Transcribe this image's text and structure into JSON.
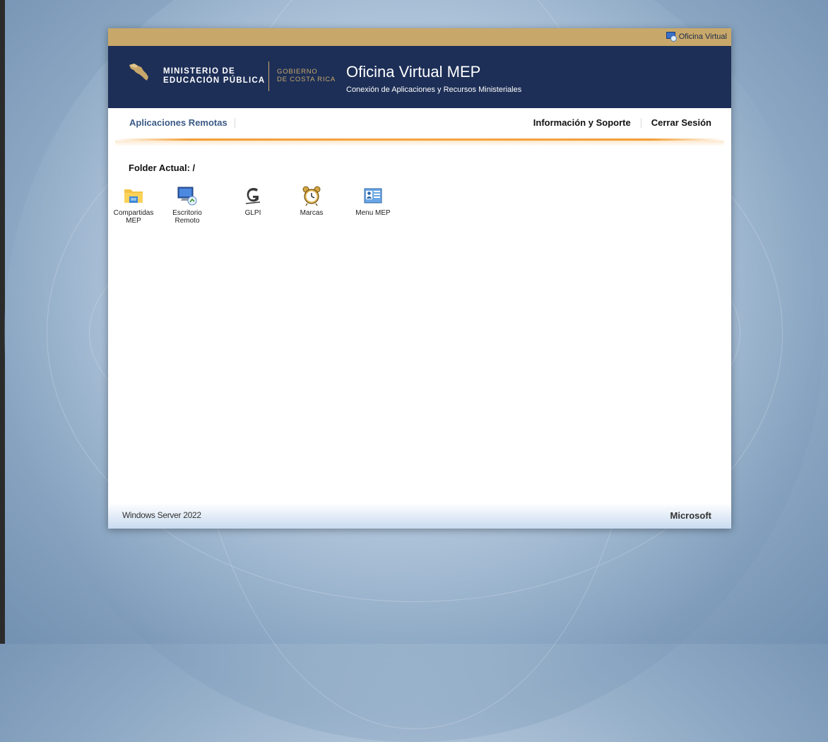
{
  "topbar": {
    "link_label": "Oficina Virtual",
    "link_icon": "remote-app-icon"
  },
  "header": {
    "ministry_line1": "MINISTERIO DE",
    "ministry_line2": "EDUCACIÓN PÚBLICA",
    "gov_line1": "GOBIERNO",
    "gov_line2": "DE COSTA RICA",
    "title": "Oficina Virtual MEP",
    "subtitle": "Conexión de Aplicaciones y Recursos Ministeriales",
    "colors": {
      "header_bg": "#1d2f57",
      "topbar_bg": "#c8a86a",
      "accent_gold": "#c8a86a"
    }
  },
  "nav": {
    "left": [
      {
        "label": "Aplicaciones Remotas"
      }
    ],
    "right": [
      {
        "label": "Información y Soporte"
      },
      {
        "label": "Cerrar Sesión"
      }
    ],
    "colors": {
      "active": "#3b5a86",
      "underline_orange": "#f29e35"
    }
  },
  "content": {
    "folder_label": "Folder Actual: /",
    "apps": [
      {
        "label": "Compartidas\nMEP",
        "icon": "folder-icon"
      },
      {
        "label": "Escritorio\nRemoto",
        "icon": "remote-desktop-icon"
      },
      {
        "label": "GLPI",
        "icon": "glpi-logo-icon"
      },
      {
        "label": "Marcas",
        "icon": "alarm-clock-icon"
      },
      {
        "label": "Menu MEP",
        "icon": "menu-app-icon"
      }
    ]
  },
  "footer": {
    "left": "Windows Server 2022",
    "right": "Microsoft"
  }
}
